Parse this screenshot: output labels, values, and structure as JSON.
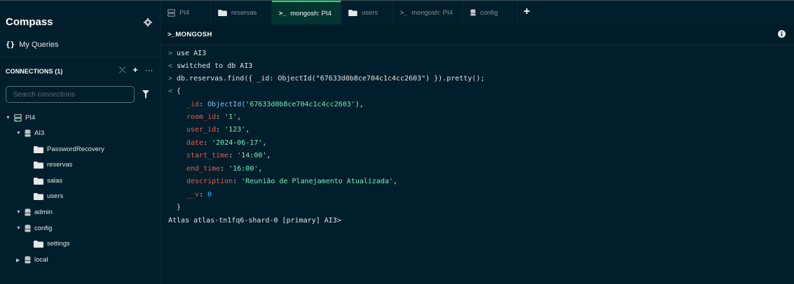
{
  "sidebar": {
    "brand": "Compass",
    "my_queries": "My Queries",
    "connections_header": "CONNECTIONS (1)",
    "search_placeholder": "Search connections",
    "tree": [
      {
        "label": "PI4",
        "level": 0,
        "type": "connection",
        "expanded": true
      },
      {
        "label": "AI3",
        "level": 1,
        "type": "database",
        "expanded": true
      },
      {
        "label": "PasswordRecovery",
        "level": 2,
        "type": "collection"
      },
      {
        "label": "reservas",
        "level": 2,
        "type": "collection"
      },
      {
        "label": "salas",
        "level": 2,
        "type": "collection"
      },
      {
        "label": "users",
        "level": 2,
        "type": "collection"
      },
      {
        "label": "admin",
        "level": 1,
        "type": "database",
        "expanded": true
      },
      {
        "label": "config",
        "level": 1,
        "type": "database",
        "expanded": true
      },
      {
        "label": "settings",
        "level": 2,
        "type": "collection"
      },
      {
        "label": "local",
        "level": 1,
        "type": "database",
        "expanded": false
      }
    ]
  },
  "tabs": [
    {
      "label": "PI4",
      "icon": "server-icon",
      "active": false
    },
    {
      "label": "reservas",
      "icon": "folder-icon",
      "active": false
    },
    {
      "label": "mongosh: PI4",
      "icon": "terminal-icon",
      "active": true
    },
    {
      "label": "users",
      "icon": "folder-icon",
      "active": false
    },
    {
      "label": "mongosh: PI4",
      "icon": "terminal-icon",
      "active": false
    },
    {
      "label": "config",
      "icon": "database-icon",
      "active": false
    }
  ],
  "shell": {
    "title": ">_MONGOSH",
    "lines": {
      "cmd1": "use AI3",
      "out1": "switched to db AI3",
      "cmd2": "db.reservas.find({ _id: ObjectId(\"67633d0b8ce704c1c4cc2603\") }).pretty();",
      "open_brace": "{",
      "id_key": "_id",
      "id_fn": "ObjectId(",
      "id_val": "'67633d0b8ce704c1c4cc2603'",
      "id_close": "),",
      "room_key": "room_id",
      "room_val": "'1'",
      "user_key": "user_id",
      "user_val": "'123'",
      "date_key": "date",
      "date_val": "'2024-06-17'",
      "start_key": "start_time",
      "start_val": "'14:00'",
      "end_key": "end_time",
      "end_val": "'16:00'",
      "desc_key": "description",
      "desc_val": "'Reunião de Planejamento Atualizada'",
      "v_key": "__v",
      "v_val": "0",
      "close_brace": "}",
      "prompt": "Atlas atlas-tn1fq6-shard-0 [primary] AI3>"
    }
  },
  "colors": {
    "background": "#001e2b",
    "accent_green": "#00ed64",
    "key_red": "#f15a4a",
    "string_green": "#71f6ba",
    "number_blue": "#2dc1ff"
  }
}
